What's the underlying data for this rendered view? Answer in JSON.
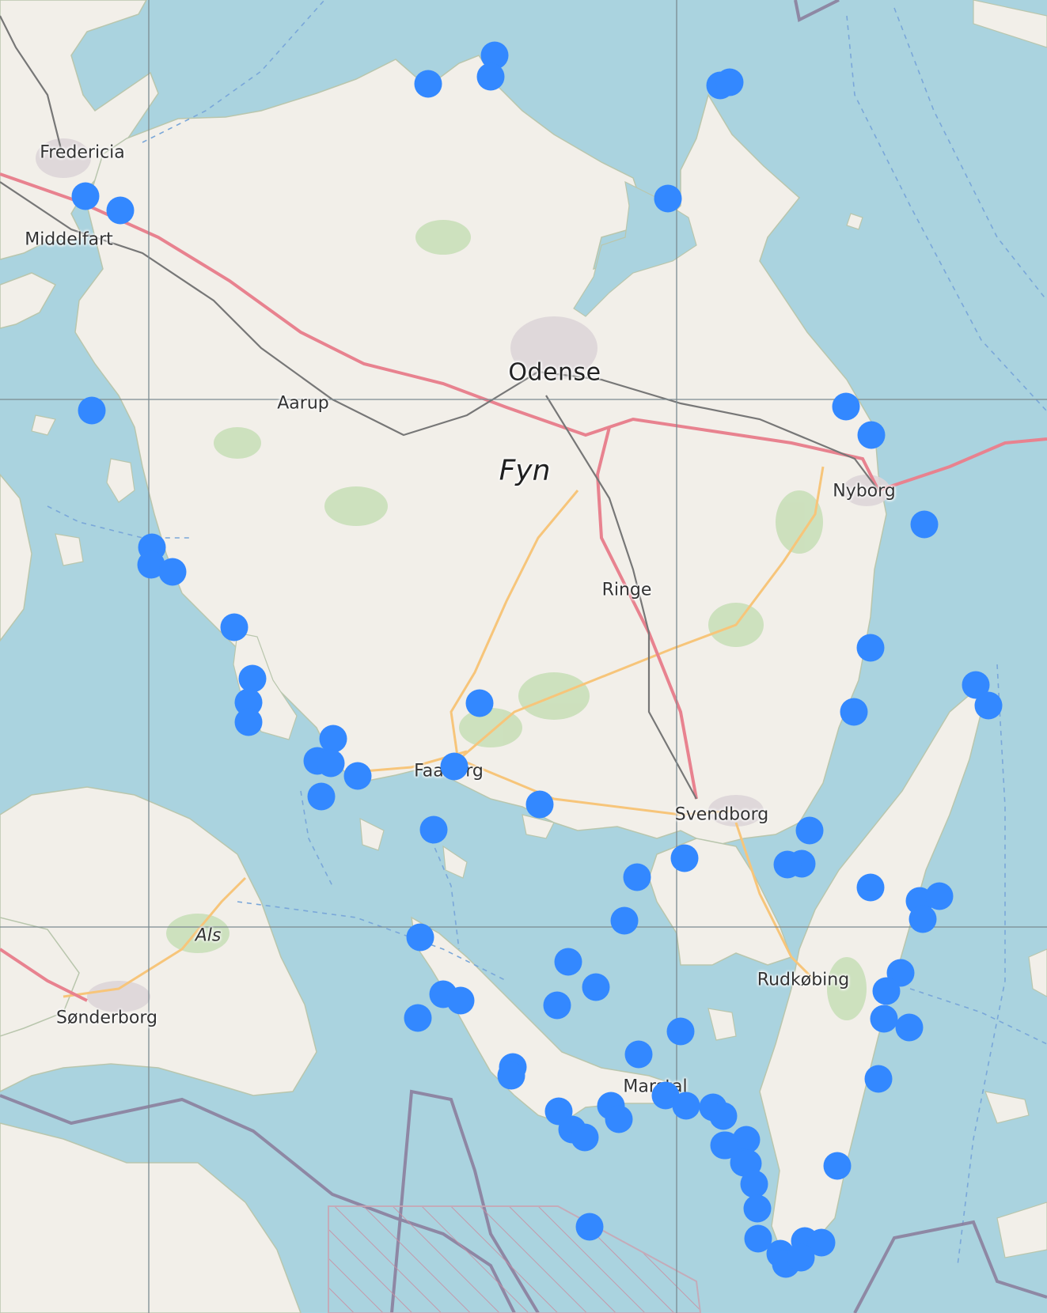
{
  "map": {
    "colors": {
      "water": "#aad3df",
      "land": "#f2efe9",
      "marker": "#3388ff",
      "motorway": "#e8828f",
      "rail": "#777777",
      "secondary_road": "#f7c57a",
      "forest": "#add19e",
      "boundary": "#8a7a9a",
      "restricted_area": "#c9a5b3"
    },
    "labels": {
      "fredericia": "Fredericia",
      "middelfart": "Middelfart",
      "odense": "Odense",
      "aarup": "Aarup",
      "fyn": "Fyn",
      "nyborg": "Nyborg",
      "ringe": "Ringe",
      "faaborg": "Faaborg",
      "svendborg": "Svendborg",
      "als": "Als",
      "sonderborg": "Sønderborg",
      "rudkobing": "Rudkøbing",
      "marstal": "Marstal"
    },
    "marker_count": 82
  }
}
